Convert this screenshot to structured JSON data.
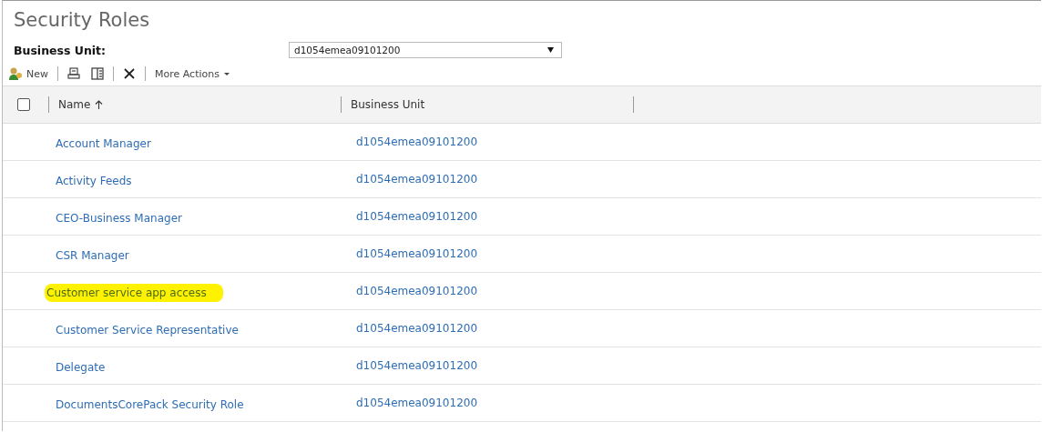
{
  "title": "Security Roles",
  "business_unit": {
    "label": "Business Unit:",
    "value": "d1054emea09101200"
  },
  "toolbar": {
    "new": "New",
    "more_actions": "More Actions"
  },
  "table": {
    "select_all_checked": false,
    "columns": [
      {
        "label": "Name",
        "sorted": true
      },
      {
        "label": "Business Unit",
        "sorted": false
      }
    ],
    "rows": [
      {
        "name": "Account Manager",
        "business_unit": "d1054emea09101200",
        "highlighted": false
      },
      {
        "name": "Activity Feeds",
        "business_unit": "d1054emea09101200",
        "highlighted": false
      },
      {
        "name": "CEO-Business Manager",
        "business_unit": "d1054emea09101200",
        "highlighted": false
      },
      {
        "name": "CSR Manager",
        "business_unit": "d1054emea09101200",
        "highlighted": false
      },
      {
        "name": "Customer service app access",
        "business_unit": "d1054emea09101200",
        "highlighted": true
      },
      {
        "name": "Customer Service Representative",
        "business_unit": "d1054emea09101200",
        "highlighted": false
      },
      {
        "name": "Delegate",
        "business_unit": "d1054emea09101200",
        "highlighted": false
      },
      {
        "name": "DocumentsCorePack Security Role",
        "business_unit": "d1054emea09101200",
        "highlighted": false
      }
    ]
  }
}
